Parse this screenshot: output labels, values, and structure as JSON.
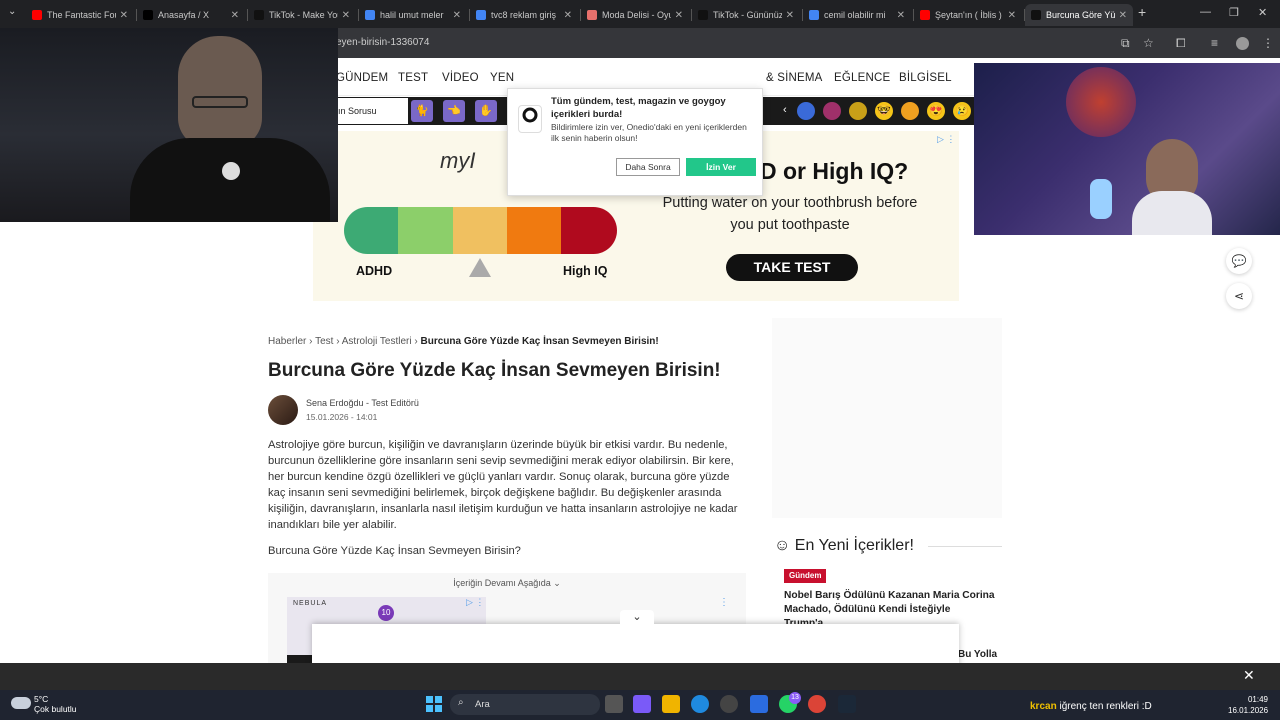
{
  "tabs": [
    {
      "label": "The Fantastic Fou",
      "color": "#ff0000"
    },
    {
      "label": "Anasayfa / X",
      "color": "#000000"
    },
    {
      "label": "TikTok - Make You",
      "color": "#111111"
    },
    {
      "label": "halil umut meler",
      "color": "#4285f4"
    },
    {
      "label": "tvc8 reklam giriş",
      "color": "#4285f4"
    },
    {
      "label": "Moda Delisi - Oyu",
      "color": "#e8706c"
    },
    {
      "label": "TikTok - Gününüz",
      "color": "#111111"
    },
    {
      "label": "cemil olabilir mi",
      "color": "#4285f4"
    },
    {
      "label": "Şeytan'ın ( İblis )",
      "color": "#ff0000"
    },
    {
      "label": "Burcuna Göre Yü",
      "color": "#111111"
    }
  ],
  "url": "eyen-birisin-1336074",
  "nav": [
    "GÜNDEM",
    "TEST",
    "VİDEO",
    "YEN",
    "& SİNEMA",
    "EĞLENCE",
    "BİLGİSEL"
  ],
  "strip_label": "ın Sorusu",
  "notification": {
    "title": "Tüm gündem, test, magazin ve goygoy içerikleri burda!",
    "subtitle": "Bildirimlere izin ver, Onedio'daki en yeni içeriklerden ilk senin haberin olsun!",
    "later": "Daha Sonra",
    "allow": "İzin Ver"
  },
  "ad": {
    "logo": "myI",
    "headline": "D or High IQ?",
    "sub": "Putting water on your toothbrush before you put toothpaste",
    "button": "TAKE TEST",
    "left_label": "ADHD",
    "right_label": "High IQ",
    "scale_colors": [
      "#3daa74",
      "#8ccf6a",
      "#f0c060",
      "#f07a10",
      "#b00a1e"
    ]
  },
  "breadcrumb": {
    "items": [
      "Haberler",
      "Test",
      "Astroloji Testleri"
    ],
    "current": "Burcuna Göre Yüzde Kaç İnsan Sevmeyen Birisin!"
  },
  "article": {
    "title": "Burcuna Göre Yüzde Kaç İnsan Sevmeyen Birisin!",
    "author": "Sena Erdoğdu",
    "role": "Test Editörü",
    "date": "15.01.2026 - 14:01",
    "body": "Astrolojiye göre burcun, kişiliğin ve davranışların üzerinde büyük bir etkisi vardır. Bu nedenle, burcunun özelliklerine göre insanların seni sevip sevmediğini merak ediyor olabilirsin. Bir kere, her burcun kendine özgü özellikleri ve güçlü yanları vardır. Sonuç olarak, burcuna göre yüzde kaç insanın seni sevmediğini belirlemek, birçok değişkene bağlıdır. Bu değişkenler arasında kişiliğin, davranışların, insanlarla nasıl iletişim kurduğun ve hatta insanların astrolojiye ne kadar inandıkları bile yer alabilir.",
    "question": "Burcuna Göre Yüzde Kaç İnsan Sevmeyen Birisin?",
    "embed_caption": "İçeriğin Devamı Aşağıda",
    "embed_brand": "NEBULA",
    "embed_number": "10"
  },
  "sidebar": {
    "latest_title": "En Yeni İçerikler!",
    "tag": "Gündem",
    "headline": "Nobel Barış Ödülünü Kazanan Maria Corina Machado, Ödülünü Kendi İsteğiyle Trump'a...",
    "headline2": "Bu Yolla"
  },
  "taskbar": {
    "temp": "5°C",
    "weather": "Çok bulutlu",
    "search": "Ara",
    "badge": "13",
    "chat_user": "krcan",
    "chat_msg": "iğrenç ten renkleri :D",
    "time": "01:49",
    "date": "16.01.2026"
  }
}
